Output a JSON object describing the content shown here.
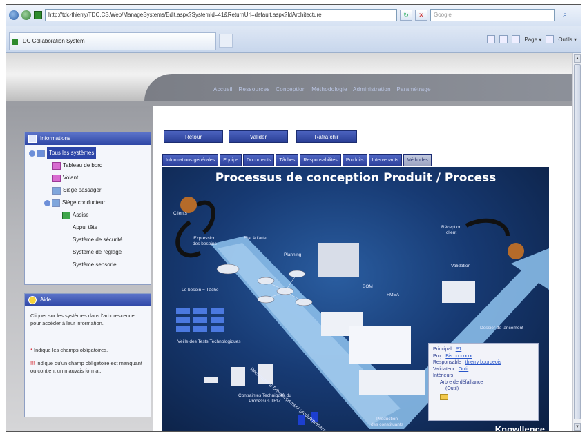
{
  "browser": {
    "url": "http://tdc-thierry/TDC.CS.Web/ManageSystems/Edit.aspx?SystemId=41&ReturnUrl=default.aspx?IdArchitecture",
    "search_placeholder": "Google",
    "tab_title": "TDC Collaboration System",
    "cmd_page": "Page ▾",
    "cmd_tools": "Outils ▾"
  },
  "topnav": {
    "items": [
      "Accueil",
      "Ressources",
      "Conception",
      "Méthodologie",
      "Administration",
      "Paramétrage"
    ]
  },
  "sidebar": {
    "info_title": "Informations",
    "tree": [
      {
        "label": "Tous les systèmes",
        "selected": true
      },
      {
        "label": "Tableau de bord"
      },
      {
        "label": "Volant"
      },
      {
        "label": "Siège passager"
      },
      {
        "label": "Siège conducteur"
      },
      {
        "label": "Assise"
      },
      {
        "label": "Appui tête"
      },
      {
        "label": "Système de sécurité"
      },
      {
        "label": "Système de réglage"
      },
      {
        "label": "Système sensoriel"
      }
    ],
    "help_title": "Aide",
    "help_text": "Cliquer sur les systèmes dans l'arborescence pour accéder à leur information.",
    "required_mark": "*",
    "required_text": " Indique les champs obligatoires.",
    "invalid_mark": "!!!",
    "invalid_text": " Indique qu'un champ obligatoire est manquant ou contient un mauvais format."
  },
  "actions": {
    "back": "Retour",
    "validate": "Valider",
    "refresh": "Rafraîchir"
  },
  "tabs": [
    {
      "label": "Informations générales"
    },
    {
      "label": "Equipe"
    },
    {
      "label": "Documents"
    },
    {
      "label": "Tâches"
    },
    {
      "label": "Responsabilités"
    },
    {
      "label": "Produits"
    },
    {
      "label": "Intervenants"
    },
    {
      "label": "Méthodes",
      "active": true
    }
  ],
  "diagram": {
    "title": "Processus de conception Produit / Process",
    "labels": {
      "clients": "Clients",
      "expression": "Expression\ndes besoins",
      "etat_art": "Etat à l'arte",
      "planning": "Planning",
      "reception": "Réception\nclient",
      "validation": "Validation",
      "veille": "Veille des Tests Technologiques",
      "contraintes": "Contraintes Techniques du\nProcessus TRIZ",
      "production": "Production\ndes constituants",
      "besoins": "Le besoin = Tâche",
      "dossier": "Dossier de lancement",
      "bom": "BOM",
      "fmea": "FMEA",
      "diagonal": "Recherche & Développement produit/process",
      "brand": "Knowllence"
    }
  },
  "info_card": {
    "rows": [
      {
        "k": "Principal : ",
        "v": "P1"
      },
      {
        "k": "Proj : ",
        "v": "Bis_xxxxxxx"
      },
      {
        "k": "Responsable : ",
        "v": "thierry bourgeois"
      },
      {
        "k": "Validateur : ",
        "v": "Outil"
      },
      {
        "k": "Intérieurs",
        "v": ""
      },
      {
        "k": "Arbre de défaillance",
        "v": ""
      },
      {
        "k": "(Outil)",
        "v": ""
      }
    ]
  },
  "colors": {
    "brand_blue": "#2c45a8",
    "diagram_bg": "#173a73",
    "required_red": "#d1121b"
  }
}
